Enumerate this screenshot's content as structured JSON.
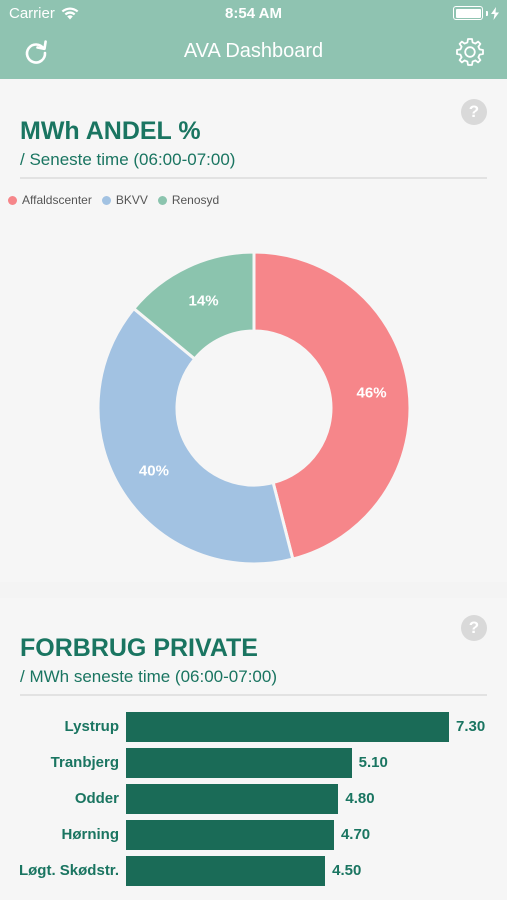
{
  "status_bar": {
    "carrier": "Carrier",
    "time": "8:54 AM"
  },
  "nav": {
    "title": "AVA Dashboard",
    "refresh_icon": "refresh-icon",
    "settings_icon": "gear-icon"
  },
  "colors": {
    "header": "#8fc3b1",
    "accent": "#1a7561",
    "bar": "#1a6b57",
    "affaldscenter": "#f6868a",
    "bkvv": "#a2c2e2",
    "renosyd": "#8bc4ae"
  },
  "share_card": {
    "title": "MWh ANDEL %",
    "subtitle": "/ Seneste time (06:00-07:00)",
    "help": "?",
    "legend": [
      "Affaldscenter",
      "BKVV",
      "Renosyd"
    ],
    "chart_data": {
      "type": "pie",
      "style": "donut",
      "labels": [
        "Affaldscenter",
        "BKVV",
        "Renosyd"
      ],
      "values": [
        46,
        40,
        14
      ],
      "value_labels": [
        "46%",
        "40%",
        "14%"
      ],
      "colors": [
        "#f6868a",
        "#a2c2e2",
        "#8bc4ae"
      ],
      "legend": "top-left"
    }
  },
  "private_card": {
    "title": "FORBRUG PRIVATE",
    "subtitle": "/ MWh seneste time (06:00-07:00)",
    "help": "?",
    "chart_data": {
      "type": "bar",
      "orientation": "horizontal",
      "categories": [
        "Lystrup",
        "Tranbjerg",
        "Odder",
        "Hørning",
        "Løgt. Skødstr."
      ],
      "values": [
        7.3,
        5.1,
        4.8,
        4.7,
        4.5
      ],
      "value_labels": [
        "7.30",
        "5.10",
        "4.80",
        "4.70",
        "4.50"
      ]
    }
  }
}
